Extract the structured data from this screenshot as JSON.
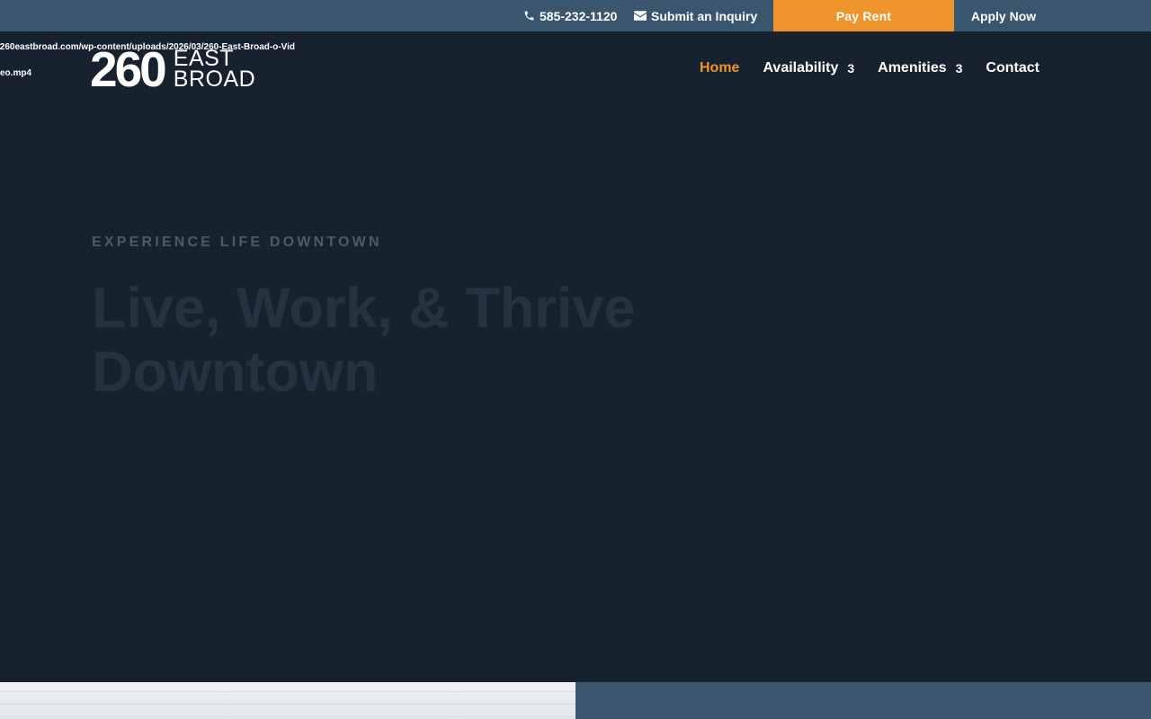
{
  "topbar": {
    "phone": "585-232-1120",
    "inquiry_label": "Submit an Inquiry",
    "pay_rent_label": "Pay Rent",
    "apply_now_label": "Apply Now",
    "phone_icon": "phone-icon",
    "inquiry_icon": "envelope-icon"
  },
  "video_fallback": {
    "url_text": "/260eastbroad.com/wp-content/uploads/2026/03/260-East-Broad-o-Video.mp4"
  },
  "logo": {
    "number": "260",
    "line1": "EAST",
    "line2": "BROAD"
  },
  "nav": {
    "items": [
      {
        "label": "Home",
        "active": true,
        "badge": ""
      },
      {
        "label": "Availability",
        "active": false,
        "badge": "3"
      },
      {
        "label": "Amenities",
        "active": false,
        "badge": "3"
      },
      {
        "label": "Contact",
        "active": false,
        "badge": ""
      }
    ]
  },
  "hero": {
    "eyebrow": "EXPERIENCE LIFE DOWNTOWN",
    "title": "Live, Work, & Thrive Downtown"
  },
  "colors": {
    "accent": "#ef932b",
    "topbar_bg": "#39566e",
    "page_bg": "#17222f"
  }
}
